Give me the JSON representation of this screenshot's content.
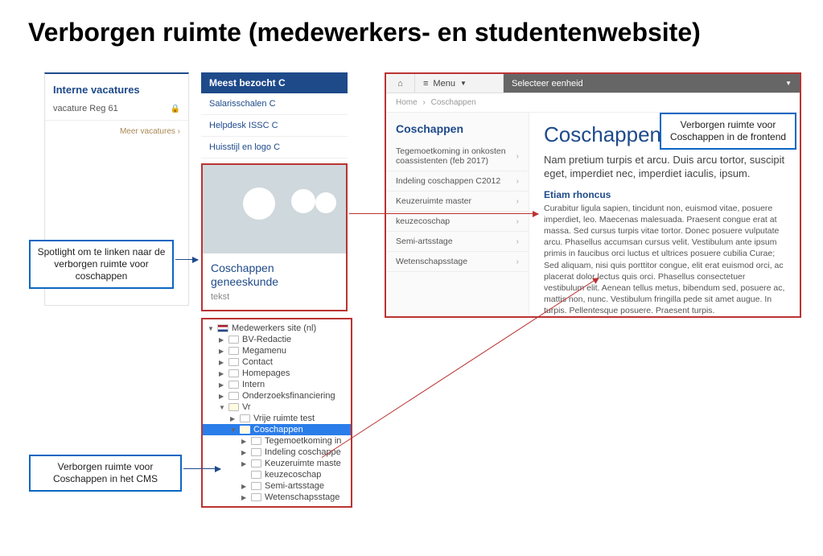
{
  "slide": {
    "title": "Verborgen ruimte (medewerkers- en studentenwebsite)"
  },
  "annotations": {
    "spotlight": "Spotlight om te linken naar de verborgen ruimte voor coschappen",
    "cms": "Verborgen ruimte voor Coschappen in het CMS",
    "frontend": "Verborgen ruimte voor Coschappen in de frontend"
  },
  "interneVacatures": {
    "title": "Interne vacatures",
    "item": "vacature Reg 61",
    "more": "Meer vacatures ›"
  },
  "meestBezocht": {
    "header": "Meest bezocht C",
    "items": [
      "Salarisschalen C",
      "Helpdesk ISSC C",
      "Huisstijl en logo C"
    ]
  },
  "spotlight": {
    "title": "Coschappen geneeskunde",
    "text": "tekst"
  },
  "cmsTree": {
    "root": "Medewerkers site (nl)",
    "level1": [
      "BV-Redactie",
      "Megamenu",
      "Contact",
      "Homepages",
      "Intern",
      "Onderzoeksfinanciering"
    ],
    "vr": {
      "label": "Vr",
      "children": [
        "Vrije ruimte test",
        "Coschappen"
      ],
      "coschappenChildren": [
        "Tegemoetkoming in",
        "Indeling coschappe",
        "Keuzeruimte maste",
        "keuzecoschap",
        "Semi-artsstage",
        "Wetenschapsstage"
      ]
    }
  },
  "frontend": {
    "menu": "Menu",
    "selecteer": "Selecteer eenheid",
    "breadcrumb": {
      "home": "Home",
      "current": "Coschappen"
    },
    "sidenav": {
      "title": "Coschappen",
      "items": [
        "Tegemoetkoming in onkosten coassistenten (feb 2017)",
        "Indeling coschappen C2012",
        "Keuzeruimte master",
        "keuzecoschap",
        "Semi-artsstage",
        "Wetenschapsstage"
      ]
    },
    "content": {
      "h1": "Coschappen",
      "intro": "Nam pretium turpis et arcu. Duis arcu tortor, suscipit eget, imperdiet nec, imperdiet iaculis, ipsum.",
      "h2": "Etiam rhoncus",
      "body": "Curabitur ligula sapien, tincidunt non, euismod vitae, posuere imperdiet, leo. Maecenas malesuada. Praesent congue erat at massa. Sed cursus turpis vitae tortor. Donec posuere vulputate arcu. Phasellus accumsan cursus velit. Vestibulum ante ipsum primis in faucibus orci luctus et ultrices posuere cubilia Curae; Sed aliquam, nisi quis porttitor congue, elit erat euismod orci, ac placerat dolor lectus quis orci. Phasellus consectetuer vestibulum elit. Aenean tellus metus, bibendum sed, posuere ac, mattis non, nunc. Vestibulum fringilla pede sit amet augue. In turpis. Pellentesque posuere. Praesent turpis."
    }
  }
}
